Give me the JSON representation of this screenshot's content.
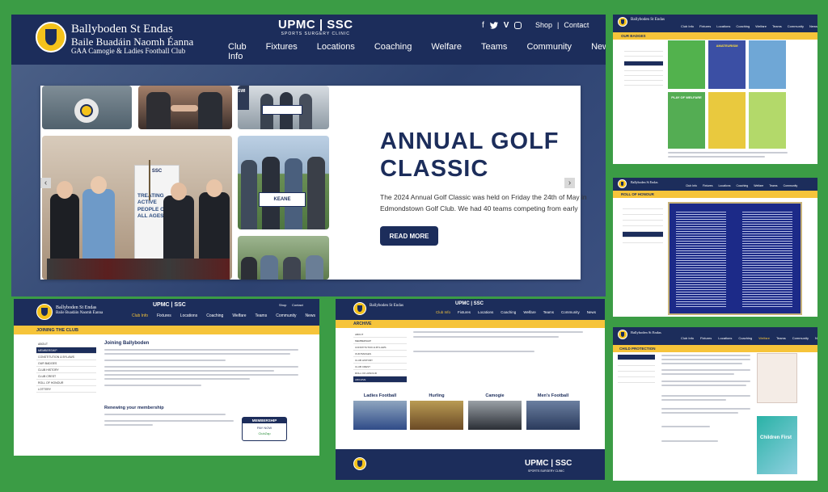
{
  "club": {
    "name_en": "Ballyboden St Endas",
    "name_ga": "Baile Buadáin Naomh Éanna",
    "subtitle": "GAA Camogie & Ladies Football Club"
  },
  "sponsor": {
    "line1": "UPMC | SSC",
    "line2": "SPORTS SURGERY CLINIC"
  },
  "top_links": {
    "shop": "Shop",
    "contact": "Contact"
  },
  "social_icons": [
    "facebook-icon",
    "twitter-icon",
    "vimeo-icon",
    "instagram-icon"
  ],
  "nav": [
    "Club Info",
    "Fixtures",
    "Locations",
    "Coaching",
    "Welfare",
    "Teams",
    "Community",
    "News"
  ],
  "hero": {
    "title": "ANNUAL GOLF CLASSIC",
    "description": "The 2024 Annual Golf Classic was held on Friday the 24th of May in Edmondstown Golf Club. We had 40 teams competing from early mornin...",
    "button": "READ MORE",
    "banner_text": "TREATING ACTIVE PEOPLE OF ALL AGES",
    "sign_text": "KEANE"
  },
  "thumb_our_badges": {
    "section": "OUR BADGES",
    "badge1": "AMATEURISM",
    "badge2": "PLAY OF WELFARE"
  },
  "thumb_roll_of_honour": {
    "section": "ROLL OF HONOUR"
  },
  "thumb_joining": {
    "section": "JOINING THE CLUB",
    "heading": "Joining Ballyboden",
    "heading2": "Renewing your membership",
    "sidebar": [
      "ABOUT",
      "MEMBERSHIP",
      "CONSTITUTION & BYLAWS",
      "OUR BADGES",
      "CLUB HISTORY",
      "CLUB CREST",
      "ROLL OF HONOUR",
      "LOTTERY"
    ],
    "badge": "MEMBERSHIP",
    "badge_sub": "PAY NOW",
    "badge_brand": "ClubZap"
  },
  "thumb_archive": {
    "section": "ARCHIVE",
    "cats": [
      "Ladies Football",
      "Hurling",
      "Camogie",
      "Men's Football"
    ],
    "sidebar": [
      "ABOUT",
      "MEMBERSHIP",
      "CONSTITUTION & BYLAWS",
      "OUR BADGES",
      "CLUB HISTORY",
      "CLUB CREST",
      "ROLL OF HONOUR",
      "ARCHIVE"
    ]
  },
  "thumb_child": {
    "section": "CHILD PROTECTION",
    "poster": "Children First"
  },
  "colors": {
    "navy": "#1c2d5b",
    "yellow": "#f6c43a",
    "green": "#3b9c45"
  }
}
